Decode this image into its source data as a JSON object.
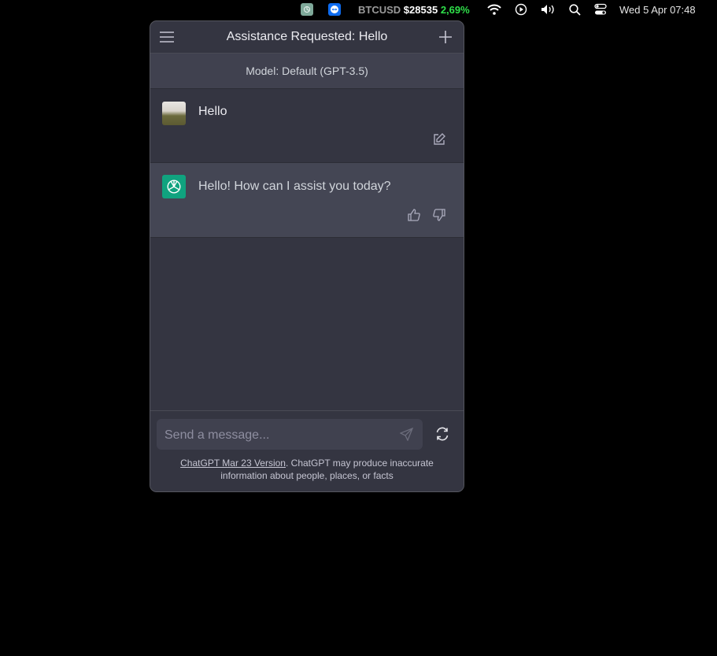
{
  "menubar": {
    "apps": [
      {
        "name": "chatgpt-menubar-app",
        "icon": "openai-logo-icon"
      },
      {
        "name": "teamviewer",
        "icon": "teamviewer-icon"
      }
    ],
    "btc": {
      "label": "BTCUSD",
      "price": "$28535",
      "change": "2,69%",
      "change_color": "#2fe04a"
    },
    "status_icons": [
      "wifi-icon",
      "play-circle-icon",
      "volume-icon",
      "search-icon",
      "control-center-icon"
    ],
    "datetime": "Wed 5 Apr  07:48"
  },
  "window": {
    "title": "Assistance Requested: Hello",
    "menu_icon": "hamburger-icon",
    "new_chat_icon": "plus-icon",
    "model_label": "Model: Default (GPT-3.5)",
    "messages": [
      {
        "role": "user",
        "text": "Hello",
        "actions": [
          "edit-icon"
        ]
      },
      {
        "role": "assistant",
        "text": "Hello! How can I assist you today?",
        "actions": [
          "thumbs-up-icon",
          "thumbs-down-icon"
        ]
      }
    ],
    "composer": {
      "placeholder": "Send a message...",
      "value": "",
      "send_icon": "paper-plane-icon",
      "regenerate_icon": "refresh-icon"
    },
    "footer": {
      "link_text": "ChatGPT Mar 23 Version",
      "disclaimer": ". ChatGPT may produce inaccurate information about people, places, or facts"
    }
  },
  "colors": {
    "accent": "#10a37f",
    "window_bg": "#343541",
    "assistant_bg": "#444654",
    "input_bg": "#40414f"
  }
}
